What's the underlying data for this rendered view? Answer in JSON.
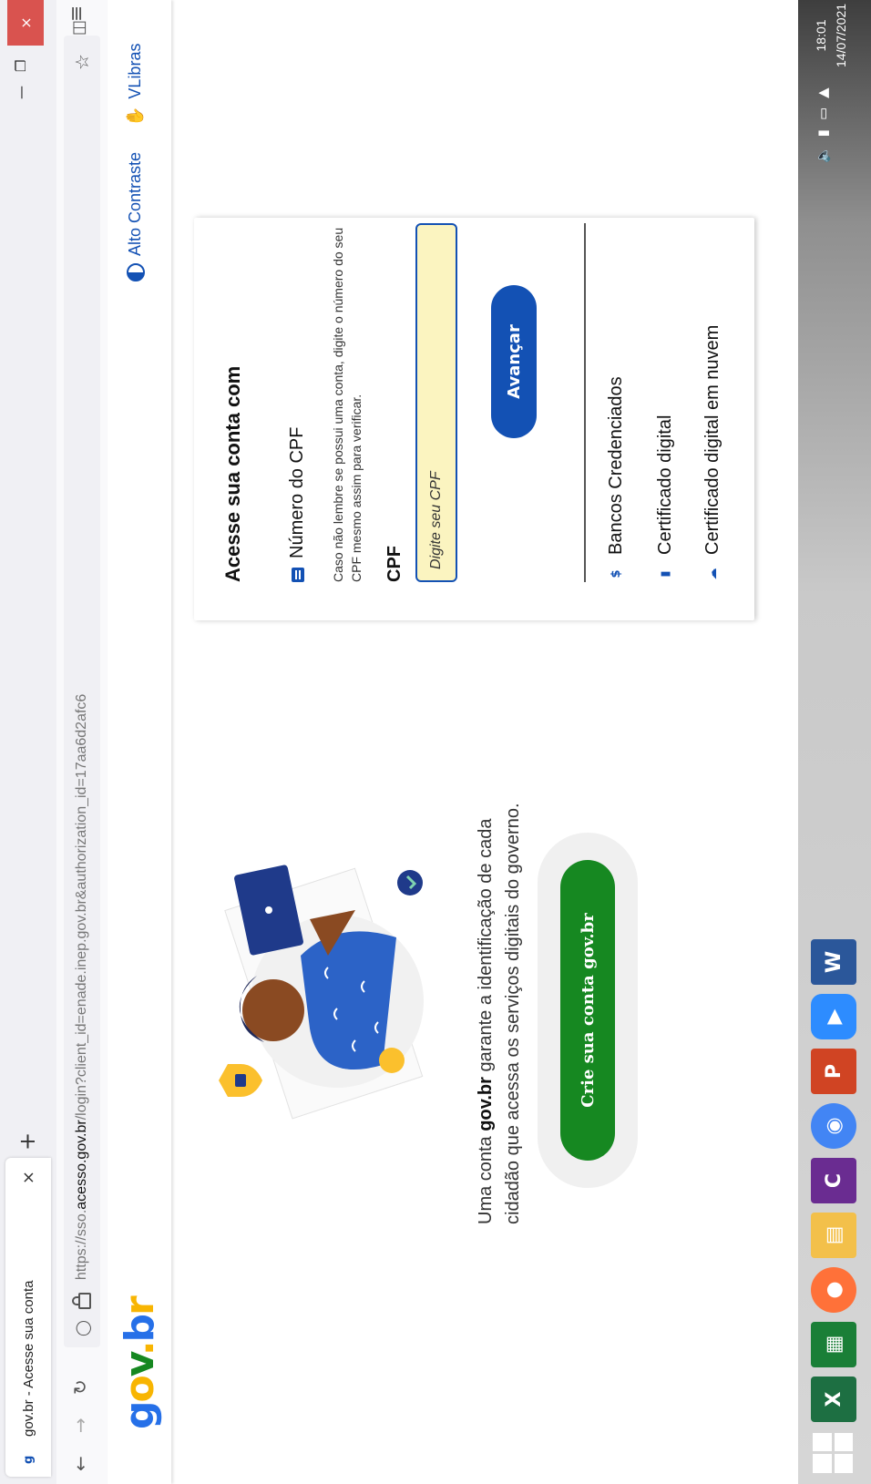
{
  "browser": {
    "tab_title": "gov.br - Acesse sua conta",
    "tab_close": "×",
    "new_tab": "+",
    "url_prefix": "https://sso.",
    "url_domain": "acesso.gov.br",
    "url_suffix": "/login?client_id=enade.inep.gov.br&authorization_id=17aa6d2afc6",
    "window_close": "×"
  },
  "header": {
    "logo": {
      "g": "g",
      "o": "o",
      "v": "v",
      "dot": ".",
      "b": "b",
      "r": "r"
    },
    "contrast_label": "Alto Contraste",
    "vlibras_label": "VLibras"
  },
  "intro": {
    "text_before": "Uma conta ",
    "brand": "gov.br",
    "text_after": " garante a identificação de cada cidadão que acessa os serviços digitais do governo."
  },
  "cta": {
    "label": "Crie sua conta gov.br"
  },
  "login": {
    "title": "Acesse sua conta com",
    "option_cpf": "Número do CPF",
    "hint": "Caso não lembre se possui uma conta, digite o número do seu CPF mesmo assim para verificar.",
    "cpf_label": "CPF",
    "cpf_placeholder": "Digite seu CPF",
    "submit": "Avançar",
    "alternatives": [
      {
        "label": "Bancos Credenciados",
        "icon": "bank-icon"
      },
      {
        "label": "Certificado digital",
        "icon": "usb-token-icon"
      },
      {
        "label": "Certificado digital em nuvem",
        "icon": "cloud-lock-icon"
      }
    ]
  },
  "taskbar": {
    "apps": [
      "start-icon",
      "excel-icon",
      "spreadsheet-icon",
      "firefox-icon",
      "file-explorer-icon",
      "pdf-tool-icon",
      "chrome-icon",
      "powerpoint-icon",
      "zoom-icon",
      "word-icon"
    ],
    "time": "18:01",
    "date": "14/07/2021"
  },
  "colors": {
    "primary_blue": "#1351b4",
    "gov_green": "#168821",
    "input_bg": "#fbf4c0",
    "close_red": "#d9534f"
  }
}
